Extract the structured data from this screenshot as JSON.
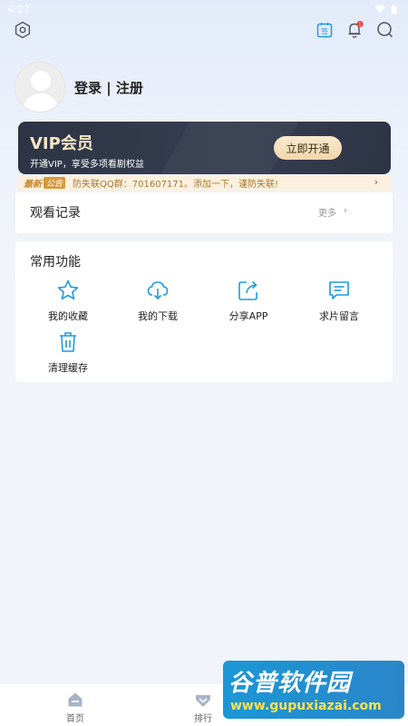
{
  "status_bar": {
    "time": "4:27"
  },
  "profile": {
    "login_label": "登录 | 注册"
  },
  "vip": {
    "title": "VIP会员",
    "subtitle": "开通VIP，享受多项看剧权益",
    "button_label": "立即开通"
  },
  "notice": {
    "tag_primary": "最新",
    "tag_secondary": "公告",
    "text": "防失联QQ群：701607171。添加一下，谨防失联!"
  },
  "history": {
    "title": "观看记录",
    "more_label": "更多"
  },
  "functions": {
    "title": "常用功能",
    "items": [
      {
        "label": "我的收藏",
        "icon": "star-icon"
      },
      {
        "label": "我的下载",
        "icon": "cloud-download-icon"
      },
      {
        "label": "分享APP",
        "icon": "share-icon"
      },
      {
        "label": "求片留言",
        "icon": "message-icon"
      },
      {
        "label": "清理缓存",
        "icon": "trash-icon"
      }
    ]
  },
  "bottom_nav": {
    "items": [
      {
        "label": "首页",
        "icon": "home-icon"
      },
      {
        "label": "排行",
        "icon": "ranking-icon"
      }
    ]
  },
  "watermark": {
    "main": "谷普软件园",
    "sub": "www.gupuxiazai.com"
  },
  "colors": {
    "accent": "#1e9be0",
    "vip_gold": "#f7e6c4",
    "vip_dark": "#2d3445",
    "notice_bg": "#fcf1df"
  }
}
